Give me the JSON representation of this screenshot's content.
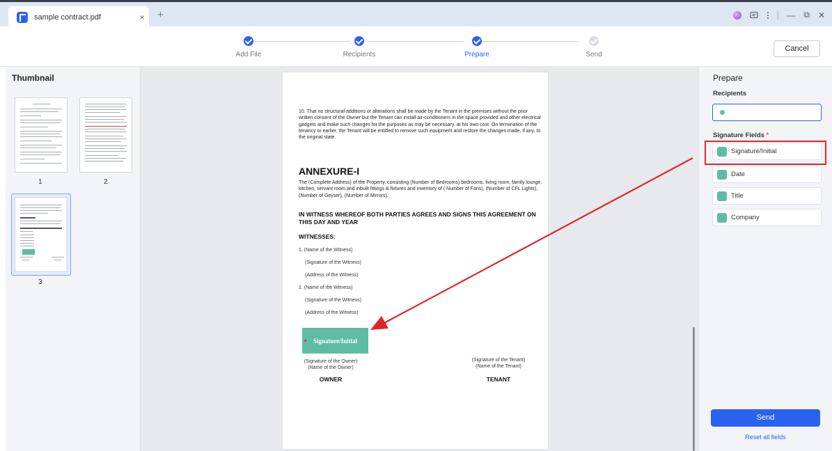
{
  "tab": {
    "title": "sample contract.pdf",
    "close": "×",
    "new": "+"
  },
  "window": {
    "minimize": "—",
    "restore": "⧉",
    "close": "✕"
  },
  "steps": [
    {
      "label": "Add File",
      "state": "done"
    },
    {
      "label": "Recipients",
      "state": "done"
    },
    {
      "label": "Prepare",
      "state": "active"
    },
    {
      "label": "Send",
      "state": "pending"
    }
  ],
  "cancel_label": "Cancel",
  "thumbnail": {
    "title": "Thumbnail",
    "pages": [
      "1",
      "2",
      "3"
    ],
    "selected": "3"
  },
  "document": {
    "clause10": "10. That no structural additions or alterations shall be made by the Tenant in the premises without the prior written consent of the Owner but the Tenant can install air-conditioners in the space provided and other electrical gadgets and make such changes for the purposes as may be necessary, at his own cost. On termination of the tenancy or earlier, the Tenant will be entitled to remove such equipment and restore the changes made, if any, to the original state.",
    "annexure_title": "ANNEXURE-I",
    "annexure_text": "The (Complete Address) of the Property, consisting (Number of Bedrooms) bedrooms, living room, family lounge, kitchen, servant room and inbuilt fittings & fixtures and inventory of ( Number of Fans), (Number of CFL Lights), (Number of Geyser), (Number of Mirrors).",
    "witness_heading": "IN WITNESS WHEREOF BOTH PARTIES AGREES AND SIGNS THIS AGREEMENT ON THIS DAY AND YEAR",
    "witnesses_label": "WITNESSES:",
    "witness_lines": [
      "1. (Name of the Witness)",
      "(Signature of the Witness)",
      "(Address of the Witness)",
      "2. (Name of the Witness)",
      "(Signature of the Witness)",
      "(Address of the Witness)"
    ],
    "placed_field": "Signature/Initial",
    "owner_sig": "(Signature of the Owner)",
    "owner_name": "(Name of the Owner)",
    "owner_label": "OWNER",
    "tenant_sig": "(Signature of the Tenant)",
    "tenant_name": "(Name of the Tenant)",
    "tenant_label": "TENANT"
  },
  "prepare": {
    "title": "Prepare",
    "recipients_label": "Recipients",
    "signature_fields_label": "Signature Fields",
    "required_mark": "*",
    "fields": [
      "Signature/Initial",
      "Date",
      "Title",
      "Company"
    ],
    "send_label": "Send",
    "reset_label": "Reset all fields"
  },
  "colors": {
    "accent": "#2a62f0",
    "field": "#5fbca4",
    "annotation": "#e0252a"
  }
}
